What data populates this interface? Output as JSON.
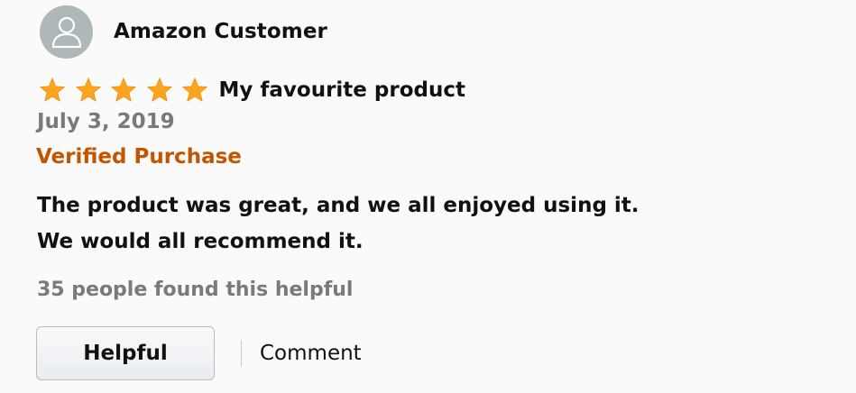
{
  "review": {
    "reviewer_name": "Amazon Customer",
    "avatar_icon": "user-silhouette-icon",
    "rating": 5,
    "rating_max": 5,
    "star_icon": "star-icon",
    "star_color": "#ffa41c",
    "title": "My favourite product",
    "date": "July 3, 2019",
    "verified_label": "Verified Purchase",
    "verified_color": "#c45500",
    "body_lines": [
      "The product was great, and we all enjoyed using it.",
      "We would all recommend it."
    ],
    "helpful_count_text": "35 people found this helpful"
  },
  "actions": {
    "helpful_label": "Helpful",
    "comment_label": "Comment"
  }
}
